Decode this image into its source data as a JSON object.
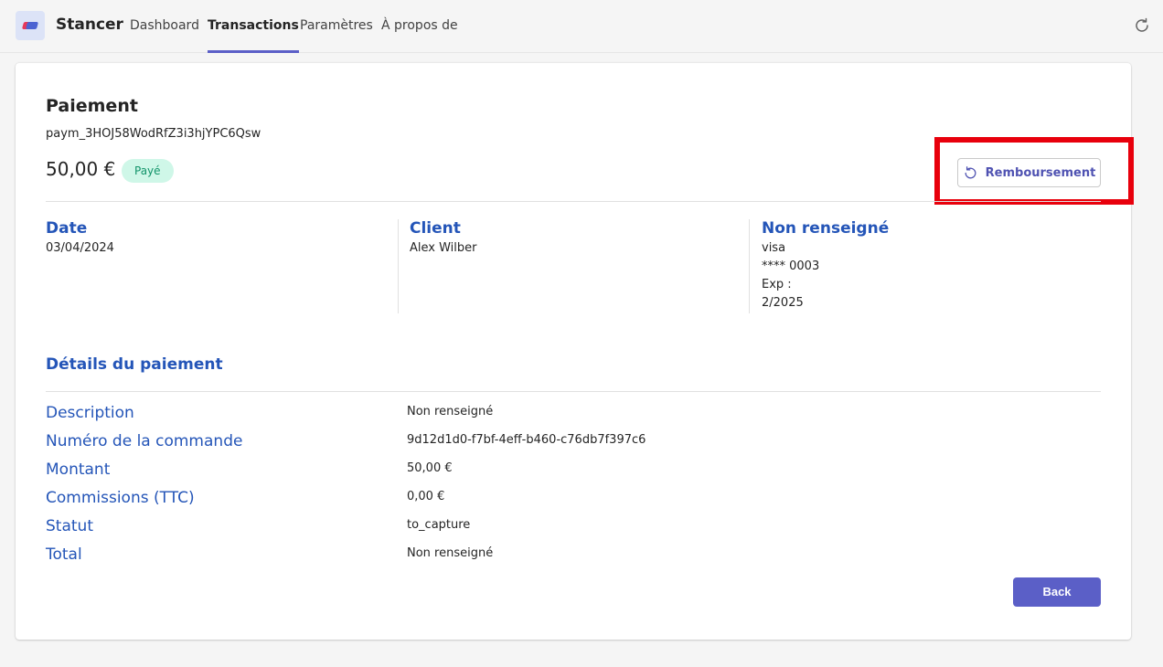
{
  "app": {
    "name": "Stancer"
  },
  "nav": {
    "tabs": [
      {
        "label": "Dashboard"
      },
      {
        "label": "Transactions"
      },
      {
        "label": "Paramètres"
      },
      {
        "label": "À propos de"
      }
    ],
    "active": "Transactions"
  },
  "payment": {
    "title": "Paiement",
    "id": "paym_3HOJ58WodRfZ3i3hjYPC6Qsw",
    "amount": "50,00 €",
    "status_badge": "Payé",
    "refund_label": "Remboursement"
  },
  "summary": {
    "date": {
      "heading": "Date",
      "value": "03/04/2024"
    },
    "client": {
      "heading": "Client",
      "value": "Alex Wilber"
    },
    "card": {
      "heading": "Non renseigné",
      "brand": "visa",
      "number": "**** 0003",
      "exp_label": "Exp :",
      "exp_value": "2/2025"
    }
  },
  "details": {
    "heading": "Détails du paiement",
    "rows": [
      {
        "label": "Description",
        "value": "Non renseigné"
      },
      {
        "label": "Numéro de la commande",
        "value": "9d12d1d0-f7bf-4eff-b460-c76db7f397c6"
      },
      {
        "label": "Montant",
        "value": "50,00 €"
      },
      {
        "label": "Commissions (TTC)",
        "value": "0,00 €"
      },
      {
        "label": "Statut",
        "value": "to_capture"
      },
      {
        "label": "Total",
        "value": "Non renseigné"
      }
    ]
  },
  "back_label": "Back",
  "colors": {
    "accent": "#5b5fc7",
    "heading_blue": "#2455b8",
    "highlight": "#e8000c",
    "badge_bg": "#cff7e8",
    "badge_text": "#12946a"
  }
}
